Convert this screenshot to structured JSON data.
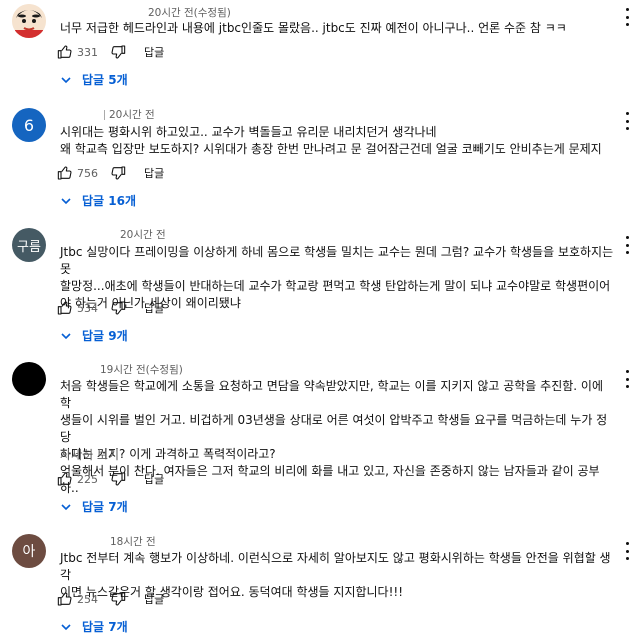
{
  "comments": [
    {
      "avatar_text": "",
      "avatar_color": "#f3e6d8",
      "time": "20시간 전(수정됨)",
      "lines": [
        "너무 저급한 헤드라인과 내용에 jtbc인줄도 몰랐음.. jtbc도 진짜 예전이 아니구나.. 언론 수준 참 ㅋㅋ"
      ],
      "likes": "331",
      "reply_label": "답글",
      "replies_label": "답글 5개"
    },
    {
      "avatar_text": "6",
      "avatar_color": "#1565c0",
      "time": "20시간 전",
      "lines": [
        "시위대는 평화시위 하고있고.. 교수가 벽돌들고 유리문 내리치던거 생각나네",
        "왜 학교측 입장만 보도하지? 시위대가 총장 한번 만나려고 문 걸어잠근건데 얼굴 코빼기도 안비추는게 문제지"
      ],
      "likes": "756",
      "reply_label": "답글",
      "replies_label": "답글 16개"
    },
    {
      "avatar_text": "구름",
      "avatar_color": "#455a64",
      "time": "20시간 전",
      "lines": [
        "Jtbc 실망이다 프레이밍을 이상하게 하네 몸으로 학생들 밀치는 교수는 뭔데 그럼? 교수가 학생들을 보호하지는 못",
        "할망정...애초에 학생들이 반대하는데 교수가 학교랑 편먹고 학생 탄압하는게 말이 되냐 교수야말로 학생편이어",
        "야 하는거 아닌가 세상이 왜이리됐냐"
      ],
      "likes": "534",
      "reply_label": "답글",
      "replies_label": "답글 9개"
    },
    {
      "avatar_text": "",
      "avatar_color": "#000000",
      "time": "19시간 전(수정됨)",
      "lines": [
        "처음 학생들은 학교에게 소통을 요청하고 면담을 약속받았지만, 학교는 이를 지키지 않고 공학을 추진함. 이에 학",
        "생들이 시위를 벌인 거고. 비겁하게 03년생을 상대로 어른 여섯이 압박주고 학생들 요구를 먹금하는데 누가 정당",
        "하다는 거지? 이게 과격하고 폭력적이라고?",
        "억울해서 분이 찬다. 여자들은 그저 학교의 비리에 화를 내고 있고, 자신을 존중하지 않는 남자들과 같이 공부하.."
      ],
      "more_label": "자세히 보기",
      "likes": "225",
      "reply_label": "답글",
      "replies_label": "답글 7개"
    },
    {
      "avatar_text": "아",
      "avatar_color": "#6d4c41",
      "time": "18시간 전",
      "lines": [
        "Jtbc 전부터 계속 행보가 이상하네. 이런식으로 자세히 알아보지도 않고 평화시위하는 학생들 안전을 위협할 생각",
        "이면 뉴스같은거 할 생각이랑 접어요. 동덕여대 학생들 지지합니다!!!"
      ],
      "likes": "254",
      "reply_label": "답글",
      "replies_label": "답글 7개"
    }
  ]
}
